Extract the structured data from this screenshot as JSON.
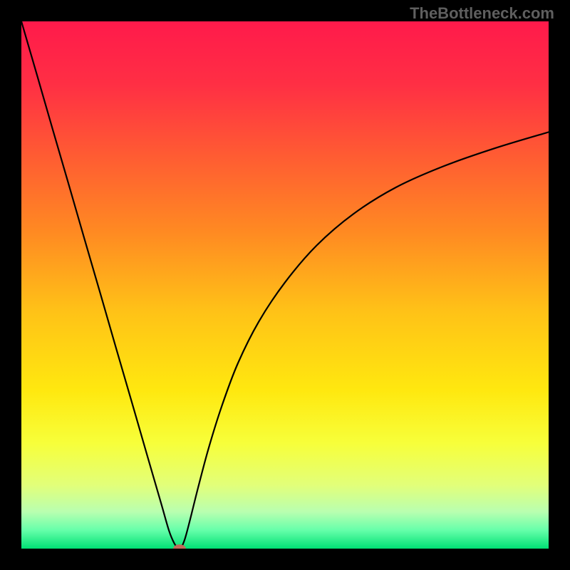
{
  "attribution": "TheBottleneck.com",
  "chart_data": {
    "type": "line",
    "title": "",
    "xlabel": "",
    "ylabel": "",
    "xlim": [
      0,
      1
    ],
    "ylim": [
      0,
      1
    ],
    "background_gradient": {
      "stops": [
        {
          "offset": 0.0,
          "color": "#ff1a4b"
        },
        {
          "offset": 0.12,
          "color": "#ff2f44"
        },
        {
          "offset": 0.25,
          "color": "#ff5a33"
        },
        {
          "offset": 0.4,
          "color": "#ff8a22"
        },
        {
          "offset": 0.55,
          "color": "#ffc217"
        },
        {
          "offset": 0.7,
          "color": "#ffe80f"
        },
        {
          "offset": 0.8,
          "color": "#f7ff3a"
        },
        {
          "offset": 0.88,
          "color": "#e2ff7a"
        },
        {
          "offset": 0.93,
          "color": "#b9ffb0"
        },
        {
          "offset": 0.965,
          "color": "#66ffaa"
        },
        {
          "offset": 1.0,
          "color": "#00e074"
        }
      ]
    },
    "series": [
      {
        "name": "bottleneck-curve",
        "x": [
          0.0,
          0.03,
          0.06,
          0.09,
          0.12,
          0.15,
          0.18,
          0.21,
          0.24,
          0.265,
          0.28,
          0.29,
          0.298,
          0.302,
          0.31,
          0.32,
          0.335,
          0.355,
          0.38,
          0.41,
          0.45,
          0.5,
          0.56,
          0.63,
          0.71,
          0.8,
          0.9,
          1.0
        ],
        "y": [
          1.0,
          0.897,
          0.793,
          0.69,
          0.586,
          0.483,
          0.379,
          0.276,
          0.172,
          0.086,
          0.034,
          0.01,
          0.0,
          0.0,
          0.018,
          0.055,
          0.115,
          0.19,
          0.27,
          0.35,
          0.43,
          0.505,
          0.575,
          0.635,
          0.685,
          0.725,
          0.76,
          0.79
        ]
      }
    ],
    "marker": {
      "x": 0.3,
      "y": 0.0,
      "rx": 0.012,
      "ry": 0.008,
      "color": "#c26a5a"
    }
  }
}
